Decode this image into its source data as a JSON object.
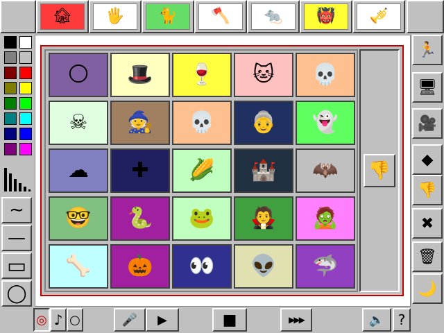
{
  "toolbar_top": {
    "categories": [
      {
        "name": "haunted-house-category",
        "icon": "🏚",
        "bg": "#ff3a3a"
      },
      {
        "name": "bloody-hands-category",
        "icon": "🖐",
        "bg": "#ffffff"
      },
      {
        "name": "black-cat-category",
        "icon": "🐈",
        "bg": "#66dd66"
      },
      {
        "name": "axe-category",
        "icon": "🪓",
        "bg": "#ffffff"
      },
      {
        "name": "mole-creature-category",
        "icon": "🐀",
        "bg": "#ffffff"
      },
      {
        "name": "monster-face-category",
        "icon": "👹",
        "bg": "#ffff33"
      },
      {
        "name": "horn-music-category",
        "icon": "🎺",
        "bg": "#ffffff"
      }
    ]
  },
  "palette": {
    "colors": [
      [
        "#000000",
        "#ffffff"
      ],
      [
        "#808080",
        "#c0c0c0"
      ],
      [
        "#800000",
        "#ff0000"
      ],
      [
        "#808000",
        "#ffff00"
      ],
      [
        "#008000",
        "#00ff00"
      ],
      [
        "#008080",
        "#00ffff"
      ],
      [
        "#000080",
        "#0000ff"
      ],
      [
        "#800080",
        "#ff00ff"
      ]
    ]
  },
  "tools": {
    "wave": "∼",
    "line": "—",
    "rect": "▭",
    "ellipse": "◯"
  },
  "gallery": {
    "cells": [
      {
        "icon": "🌕",
        "bg": "#8060a0"
      },
      {
        "icon": "🎩",
        "bg": "#ffffc0"
      },
      {
        "icon": "🍷",
        "bg": "#ffff40"
      },
      {
        "icon": "🐱",
        "bg": "#ffc0c0"
      },
      {
        "icon": "💀",
        "bg": "#ffc090"
      },
      {
        "icon": "☠",
        "bg": "#e0ffe0"
      },
      {
        "icon": "🧙",
        "bg": "#a08060"
      },
      {
        "icon": "💀",
        "bg": "#ffc090"
      },
      {
        "icon": "👵",
        "bg": "#203060"
      },
      {
        "icon": "👻",
        "bg": "#60ff60"
      },
      {
        "icon": "☁",
        "bg": "#8080c0"
      },
      {
        "icon": "✚",
        "bg": "#202060"
      },
      {
        "icon": "🌽",
        "bg": "#c0ffc0"
      },
      {
        "icon": "🏰",
        "bg": "#203040"
      },
      {
        "icon": "🦇",
        "bg": "#c0c0c0"
      },
      {
        "icon": "🤓",
        "bg": "#80c080"
      },
      {
        "icon": "🐍",
        "bg": "#a020a0"
      },
      {
        "icon": "🐸",
        "bg": "#c0ffc0"
      },
      {
        "icon": "🧛",
        "bg": "#40a040"
      },
      {
        "icon": "🧟",
        "bg": "#ff80ff"
      },
      {
        "icon": "🦴",
        "bg": "#c0ffff"
      },
      {
        "icon": "🎃",
        "bg": "#a020a0"
      },
      {
        "icon": "👀",
        "bg": "#303090"
      },
      {
        "icon": "👽",
        "bg": "#e0e0b0"
      },
      {
        "icon": "🦈",
        "bg": "#9040c0"
      }
    ]
  },
  "scroll": {
    "thumb_icon": "👎"
  },
  "right_tools": [
    {
      "name": "animation-stamp-tool",
      "icon": "🏃"
    },
    {
      "name": "computer-tool",
      "icon": "🖥"
    },
    {
      "name": "video-camera-tool",
      "icon": "🎥"
    },
    {
      "name": "eraser-tool",
      "icon": "◆"
    },
    {
      "name": "thumbs-down-tool",
      "icon": "👎"
    },
    {
      "name": "clear-screen-tool",
      "icon": "✖"
    },
    {
      "name": "trash-can-tool",
      "icon": "🗑"
    },
    {
      "name": "night-scene-tool",
      "icon": "🌙"
    }
  ],
  "bottom_bar": {
    "sound_wave": "◎",
    "note": "♪",
    "circle": "○",
    "mic": "🎤",
    "play": "▶",
    "stop": "■",
    "fast_forward": "▶▶▶",
    "speaker": "🔈",
    "help": "?"
  }
}
